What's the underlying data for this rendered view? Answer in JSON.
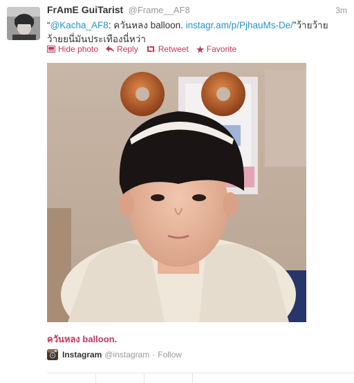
{
  "tweet": {
    "fullname": "FrAmE GuiTarist",
    "screenname": "@Frame__AF8",
    "time": "3m",
    "text_open_quote": "“",
    "mention": "@Kacha_AF8",
    "text_mid": ": ควันหลง balloon. ",
    "link": "instagr.am/p/PjhauMs-De/",
    "text_end": "”ว้ายว้ายว้ายยนี่มันประเทืองนี่หว่า"
  },
  "actions": {
    "hide_photo": "Hide photo",
    "reply": "Reply",
    "retweet": "Retweet",
    "favorite": "Favorite"
  },
  "media": {
    "caption": "ควันหลง balloon.",
    "source_name": "Instagram",
    "source_handle": "@instagram",
    "separator": "·",
    "follow": "Follow"
  },
  "colors": {
    "link": "#2a93c9",
    "accent": "#c03a5e"
  }
}
